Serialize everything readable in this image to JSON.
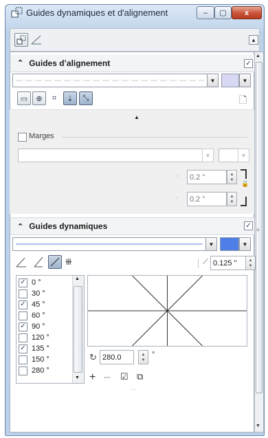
{
  "window": {
    "title": "Guides dynamiques et d'alignement"
  },
  "caption_buttons": {
    "minimize": "–",
    "maximize": "▢",
    "close": "x"
  },
  "alignment": {
    "title": "Guides d’alignement",
    "margins_label": "Marges",
    "margin_top": "0.2 \"",
    "margin_bottom": "0.2 \""
  },
  "dynamic": {
    "title": "Guides dynamiques",
    "line_color": "#4f7fe6",
    "snap_value": "0.125 \"",
    "angles": [
      {
        "label": "0 °",
        "checked": true
      },
      {
        "label": "30 °",
        "checked": false
      },
      {
        "label": "45 °",
        "checked": true
      },
      {
        "label": "60 °",
        "checked": false
      },
      {
        "label": "90 °",
        "checked": true
      },
      {
        "label": "120 °",
        "checked": false
      },
      {
        "label": "135 °",
        "checked": true
      },
      {
        "label": "150 °",
        "checked": false
      },
      {
        "label": "280 °",
        "checked": false
      }
    ],
    "rotation_value": "280.0",
    "degree_unit": "°"
  },
  "alignment_color": "#d9d8f4"
}
